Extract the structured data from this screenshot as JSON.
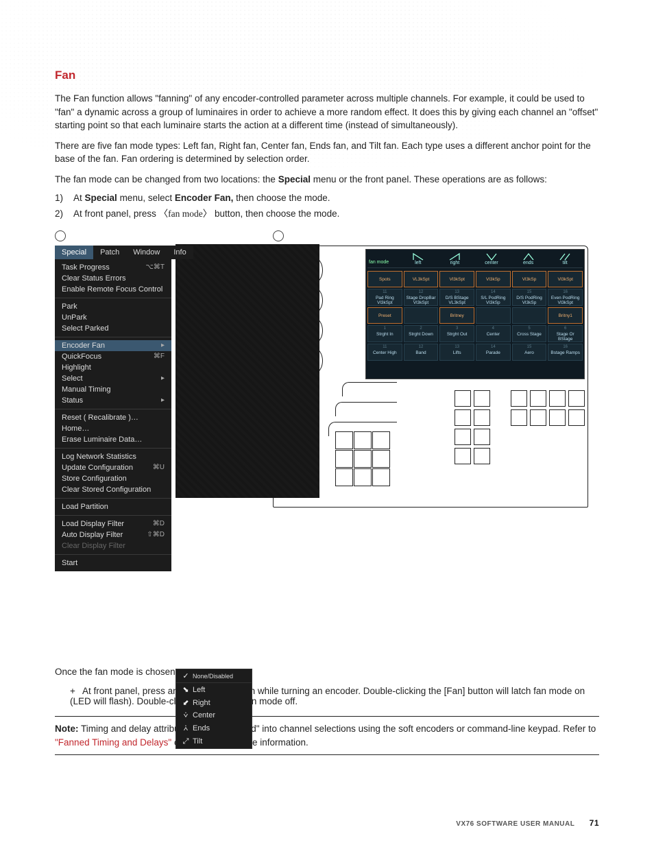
{
  "heading": "Fan",
  "para1": "The Fan function allows \"fanning\" of any encoder-controlled parameter across multiple channels. For example, it could be used to \"fan\" a dynamic across a group of luminaires in order to achieve a more random effect. It does this by giving each channel an \"offset\" starting point so that each luminaire starts the action at a different time (instead of simultaneously).",
  "para2": "There are five fan mode types: Left fan, Right fan, Center fan, Ends fan, and Tilt fan. Each type uses a different anchor point for the base of the fan. Fan ordering is determined by selection order.",
  "para3_a": "The fan mode can be changed from two locations: the ",
  "para3_b": "Special",
  "para3_c": " menu or the front panel. These operations are as follows:",
  "step1_a": "At ",
  "step1_b": "Special",
  "step1_c": " menu, select ",
  "step1_d": "Encoder Fan,",
  "step1_e": " then choose the mode.",
  "step2_a": "At front panel, press ",
  "step2_b": "〈fan mode〉",
  "step2_c": " button, then choose the mode.",
  "menubar": {
    "special": "Special",
    "patch": "Patch",
    "window": "Window",
    "info": "Info"
  },
  "menu": {
    "task_progress": "Task Progress",
    "task_progress_sc": "⌥⌘T",
    "clear_status": "Clear Status Errors",
    "enable_remote": "Enable Remote Focus Control",
    "park": "Park",
    "unpark": "UnPark",
    "select_parked": "Select Parked",
    "encoder_fan": "Encoder Fan",
    "quickfocus": "QuickFocus",
    "quickfocus_sc": "⌘F",
    "highlight": "Highlight",
    "select": "Select",
    "manual_timing": "Manual Timing",
    "status": "Status",
    "reset": "Reset ( Recalibrate )…",
    "home": "Home…",
    "erase": "Erase Luminaire Data…",
    "log_net": "Log Network Statistics",
    "update_cfg": "Update Configuration",
    "update_cfg_sc": "⌘U",
    "store_cfg": "Store Configuration",
    "clear_cfg": "Clear Stored Configuration",
    "load_part": "Load Partition",
    "load_filter": "Load Display Filter",
    "load_filter_sc": "⌘D",
    "auto_filter": "Auto Display Filter",
    "auto_filter_sc": "⇧⌘D",
    "clear_filter": "Clear Display Filter",
    "start": "Start"
  },
  "submenu": {
    "none": "None/Disabled",
    "left": "Left",
    "right": "Right",
    "center": "Center",
    "ends": "Ends",
    "tilt": "Tilt"
  },
  "touch": {
    "label": "fan mode",
    "modes": [
      "left",
      "right",
      "center",
      "ends",
      "tilt"
    ],
    "row1": [
      "Spots",
      "VL3kSpt",
      "Vl3kSpt",
      "Vl3kSp",
      "Vl3kSp",
      "Vl3kSpt"
    ],
    "row2n": [
      "11",
      "12",
      "13",
      "14",
      "15",
      "16"
    ],
    "row2": [
      "Pad Ring Vl3kSpt",
      "Stage DropBar Vl3kSpt",
      "D/S BStage VL3kSpt",
      "S/L PodRing Vl3kSp",
      "D/S PodRing Vl3kSp",
      "Even PodRing Vl3kSpt"
    ],
    "row3": [
      "Preset",
      "",
      "Britney",
      "",
      "",
      "Britny1"
    ],
    "row4n": [
      "1",
      "2",
      "3",
      "4",
      "5",
      "6"
    ],
    "row4": [
      "Strght In",
      "Strght Down",
      "Strght Out",
      "Center",
      "Cross Stage",
      "Stage Or BStage"
    ],
    "row5n": [
      "11",
      "12",
      "13",
      "14",
      "15",
      "16"
    ],
    "row5": [
      "Center High",
      "Band",
      "Lifts",
      "Parade",
      "Aero",
      "Bstage Ramps"
    ]
  },
  "after_heading": "Once the fan mode is chosen:",
  "after_bullet": "At front panel, press and hold [Fan] button while turning an encoder. Double-clicking the [Fan] button will latch fan mode on (LED will flash). Double-click again to turn fan mode off.",
  "note_label": "Note:",
  "note_a": "  Timing and delay attributes can be \"fanned\" into channel selections using the soft encoders or command-line keypad. Refer to ",
  "note_link": "\"Fanned Timing and Delays\"",
  "note_b": " on page 92 for more information.",
  "footer_title": "VX76 SOFTWARE USER MANUAL",
  "footer_page": "71"
}
